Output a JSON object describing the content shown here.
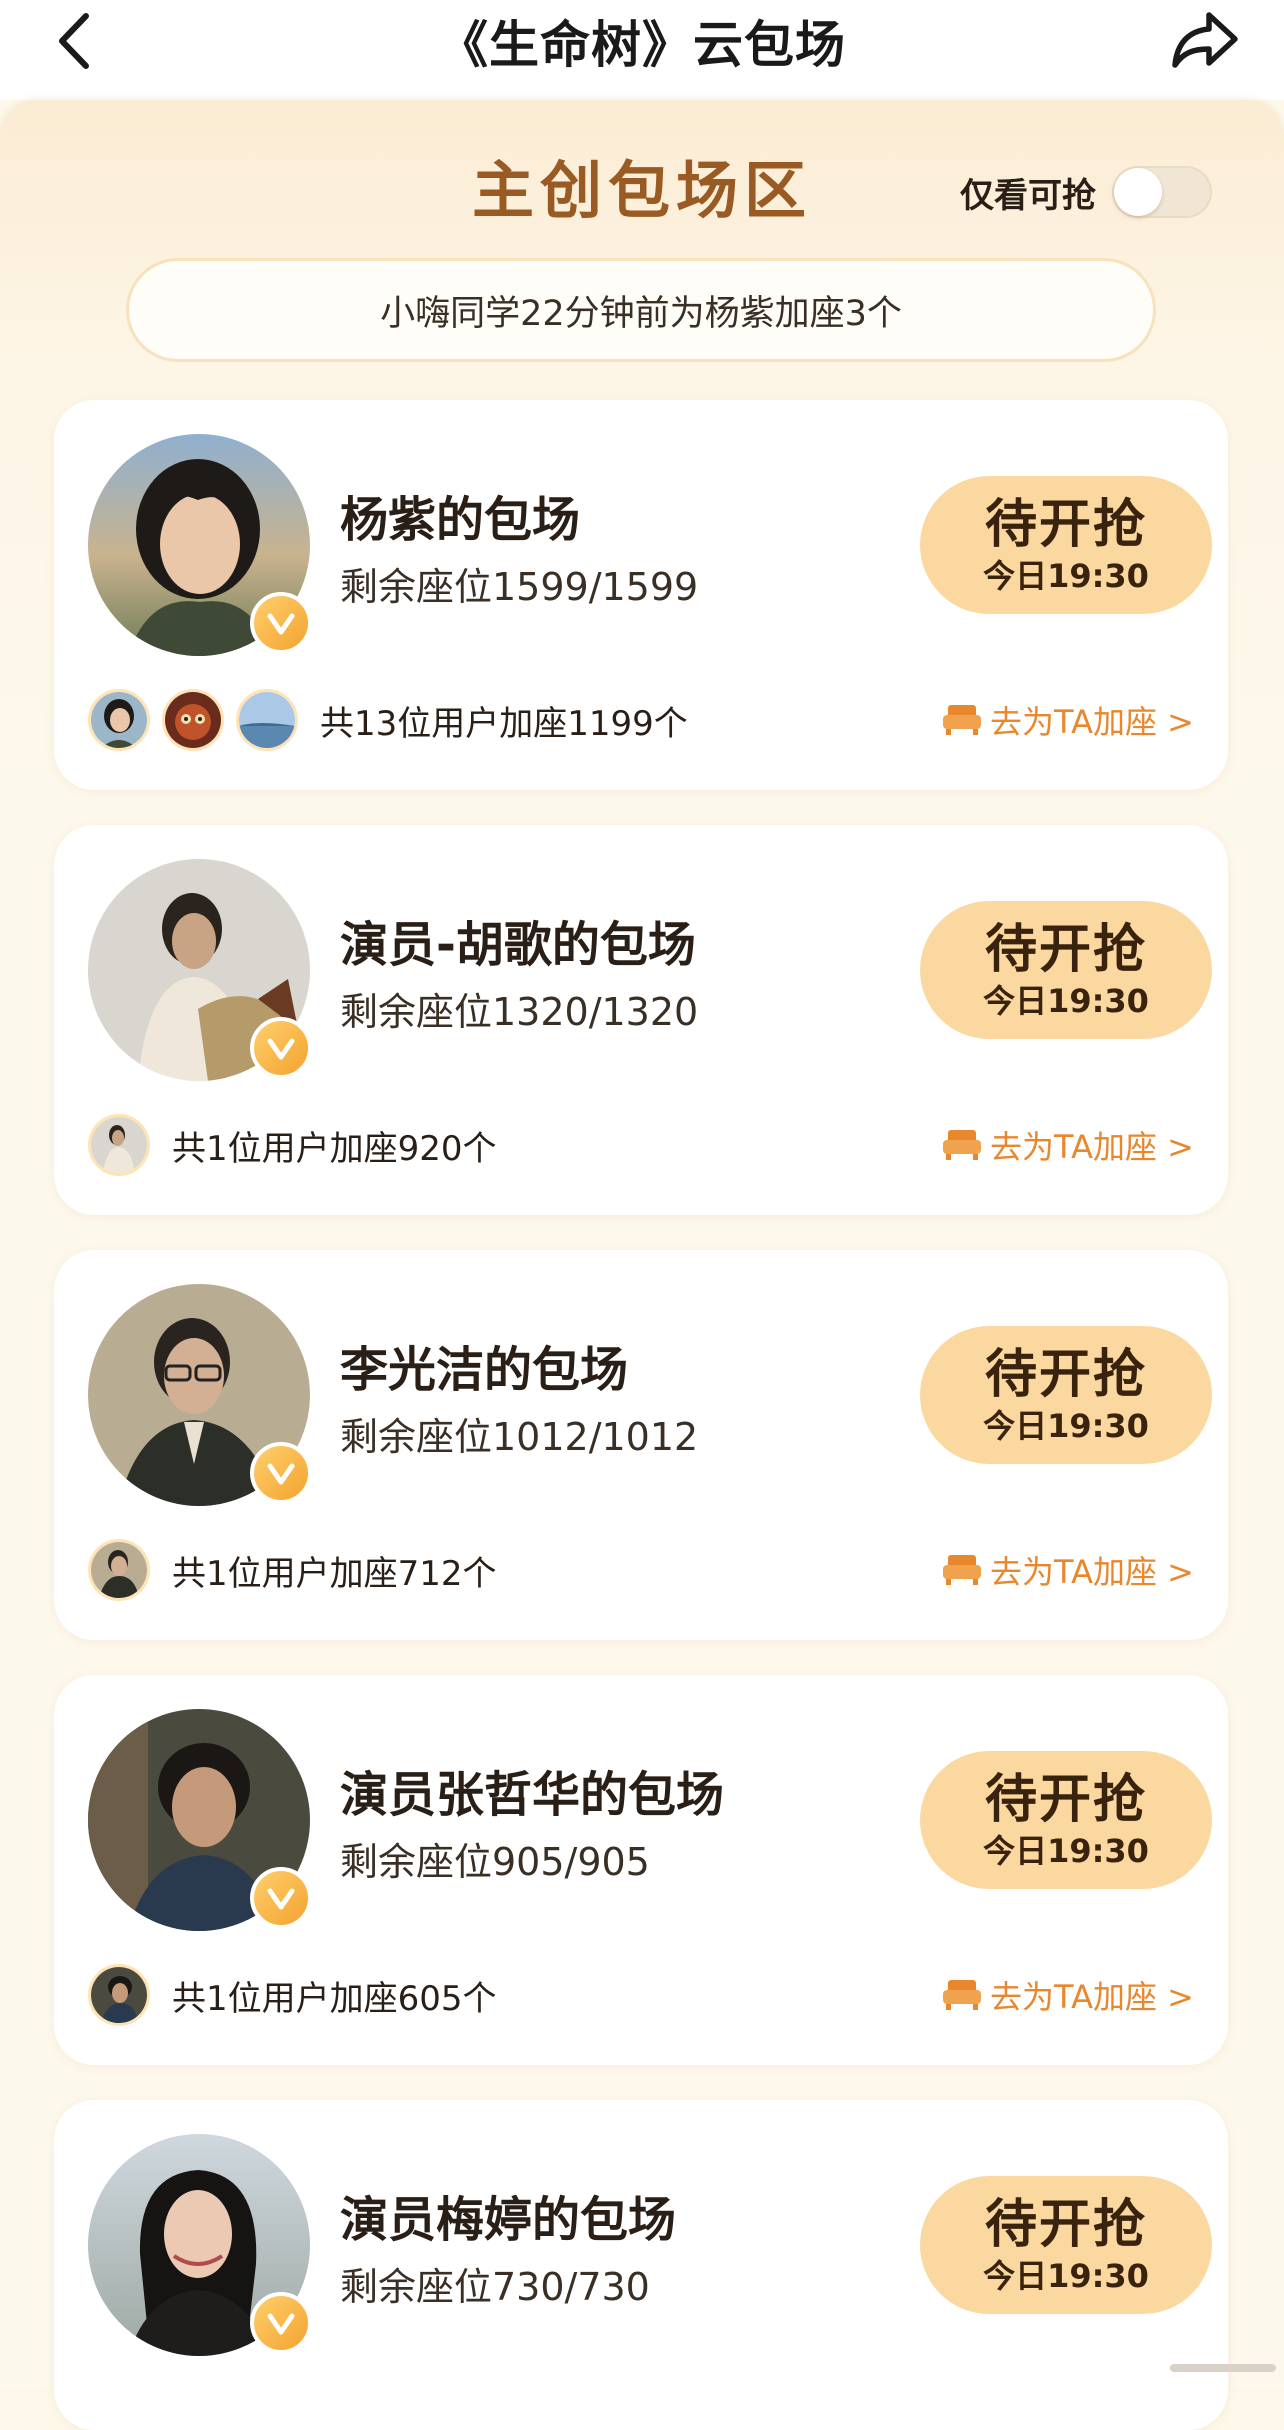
{
  "nav": {
    "title": "《生命树》云包场"
  },
  "header": {
    "section_title": "主创包场区",
    "filter_label": "仅看可抢",
    "filter_on": false,
    "ticker": "小嗨同学22分钟前为杨紫加座3个"
  },
  "colors": {
    "accent": "#9a5a24",
    "button_bg": "#fbd8a0",
    "link": "#e9872d",
    "verified": "#f3a330"
  },
  "cards": [
    {
      "title": "杨紫的包场",
      "seats": "剩余座位1599/1599",
      "button_main": "待开抢",
      "button_time": "今日19:30",
      "adders": "共13位用户加座1199个",
      "action": "去为TA加座 >"
    },
    {
      "title": "演员-胡歌的包场",
      "seats": "剩余座位1320/1320",
      "button_main": "待开抢",
      "button_time": "今日19:30",
      "adders": "共1位用户加座920个",
      "action": "去为TA加座 >"
    },
    {
      "title": "李光洁的包场",
      "seats": "剩余座位1012/1012",
      "button_main": "待开抢",
      "button_time": "今日19:30",
      "adders": "共1位用户加座712个",
      "action": "去为TA加座 >"
    },
    {
      "title": "演员张哲华的包场",
      "seats": "剩余座位905/905",
      "button_main": "待开抢",
      "button_time": "今日19:30",
      "adders": "共1位用户加座605个",
      "action": "去为TA加座 >"
    },
    {
      "title": "演员梅婷的包场",
      "seats": "剩余座位730/730",
      "button_main": "待开抢",
      "button_time": "今日19:30"
    }
  ]
}
